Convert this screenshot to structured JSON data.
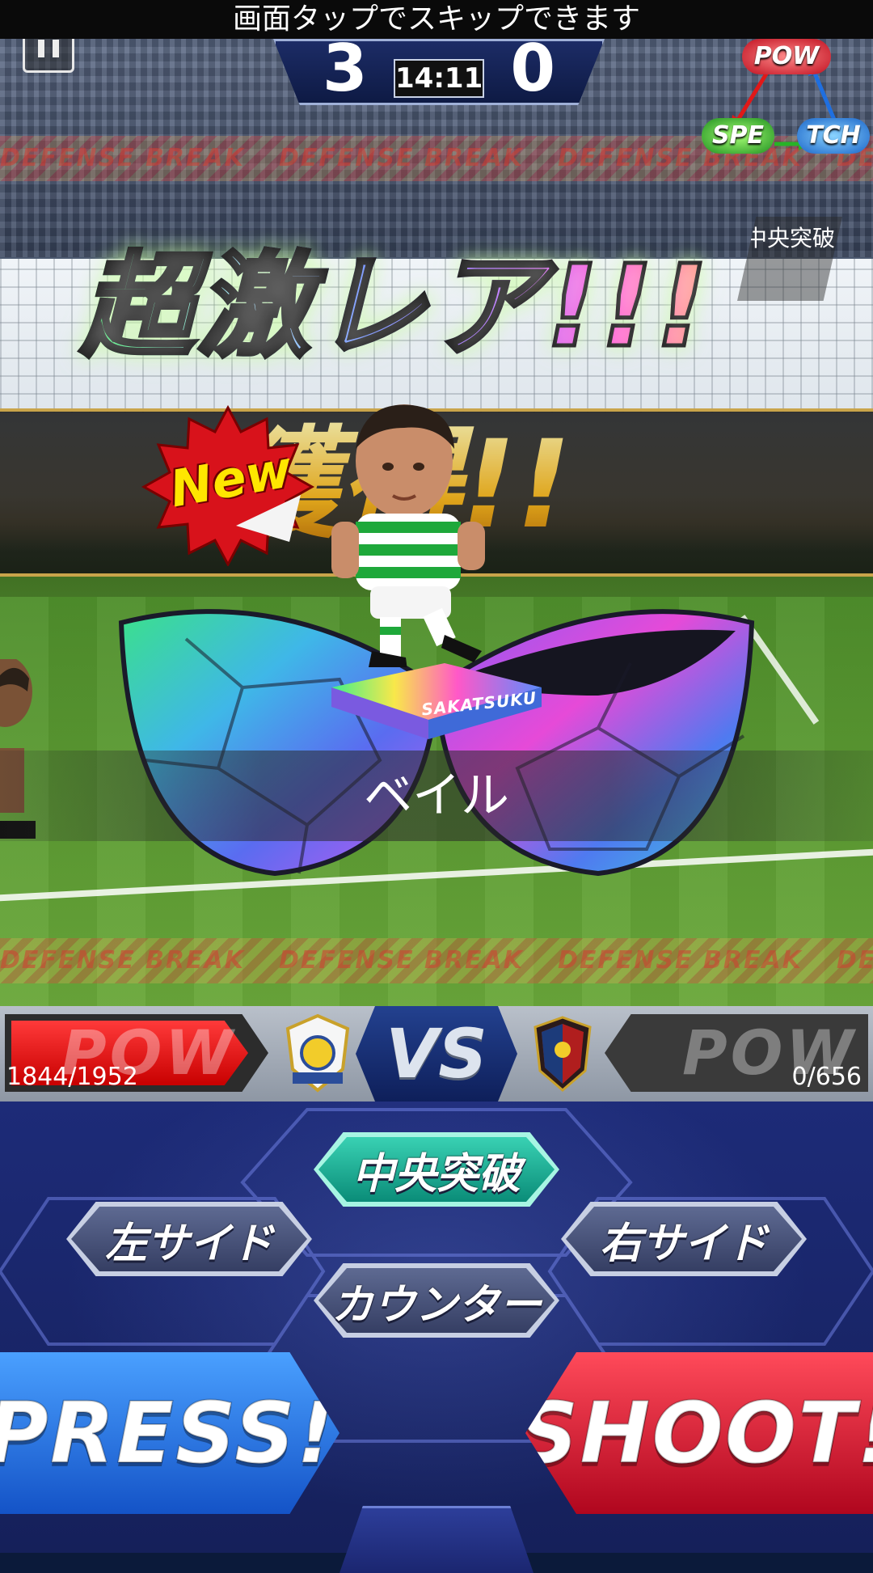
{
  "skip_banner": "画面タップでスキップできます",
  "scoreboard": {
    "home_score": "3",
    "away_score": "0",
    "clock": "14:11"
  },
  "triangle": {
    "top": "POW",
    "left": "SPE",
    "right": "TCH"
  },
  "side_tag": "中央突破",
  "tape_text": "DEFENSE BREAK",
  "headline": "超激レア!!!",
  "new_badge": "New",
  "band_text": "獲得!!",
  "platform_label": "SAKATSUKU",
  "player_name": "ベイル",
  "vs_bar": {
    "left_label": "POW",
    "left_value": "1844/1952",
    "left_fill": 0.945,
    "vs_label": "VS",
    "right_label": "POW",
    "right_value": "0/656",
    "right_fill": 0
  },
  "controls": {
    "center": "中央突破",
    "left": "左サイド",
    "right": "右サイド",
    "counter": "カウンター",
    "press": "PRESS!",
    "shoot": "SHOOT!"
  },
  "colors": {
    "pow_red": "#d40000",
    "press_blue": "#1e63d6",
    "shoot_red": "#c8102e",
    "teal": "#1fb89c"
  }
}
